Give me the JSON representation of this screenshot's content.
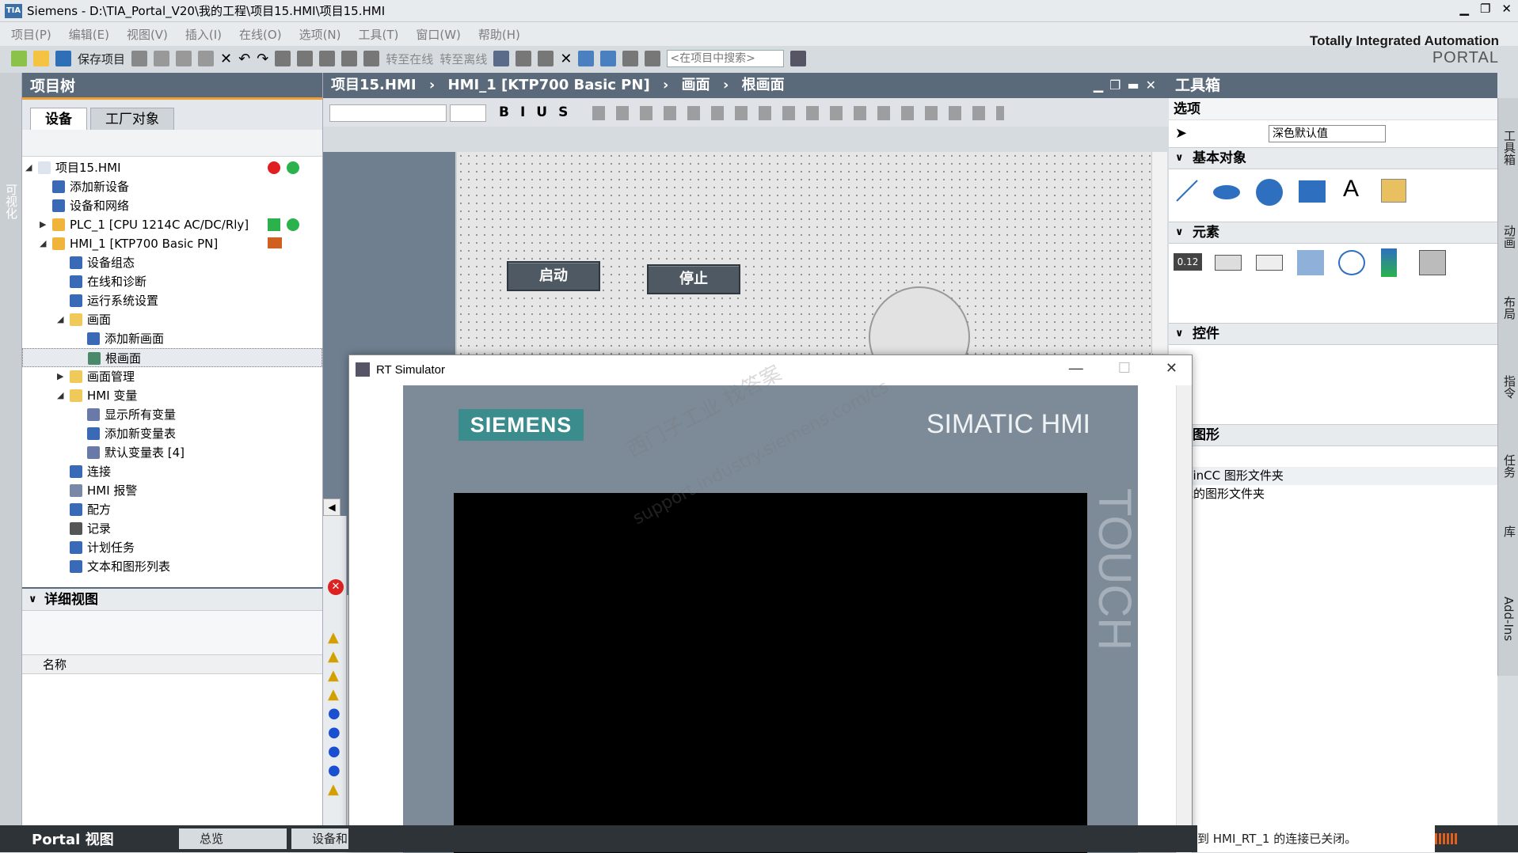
{
  "window": {
    "title": "Siemens  -  D:\\TIA_Portal_V20\\我的工程\\项目15.HMI\\项目15.HMI",
    "logo_text": "TIA"
  },
  "menu": [
    "项目(P)",
    "编辑(E)",
    "视图(V)",
    "插入(I)",
    "在线(O)",
    "选项(N)",
    "工具(T)",
    "窗口(W)",
    "帮助(H)"
  ],
  "toolbar": {
    "save_label": "保存项目",
    "go_online": "转至在线",
    "go_offline": "转至离线",
    "search_placeholder": "<在项目中搜索>"
  },
  "brand": {
    "line1": "Totally Integrated Automation",
    "line2": "PORTAL"
  },
  "left_strip": {
    "label": "可视化"
  },
  "project_tree": {
    "title": "项目树",
    "tabs": [
      "设备",
      "工厂对象"
    ],
    "items": [
      {
        "label": "项目15.HMI",
        "level": 0,
        "expanded": true
      },
      {
        "label": "添加新设备",
        "level": 1
      },
      {
        "label": "设备和网络",
        "level": 1
      },
      {
        "label": "PLC_1 [CPU 1214C AC/DC/Rly]",
        "level": 1,
        "expanded": false
      },
      {
        "label": "HMI_1 [KTP700 Basic PN]",
        "level": 1,
        "expanded": true
      },
      {
        "label": "设备组态",
        "level": 2
      },
      {
        "label": "在线和诊断",
        "level": 2
      },
      {
        "label": "运行系统设置",
        "level": 2
      },
      {
        "label": "画面",
        "level": 2,
        "expanded": true
      },
      {
        "label": "添加新画面",
        "level": 3
      },
      {
        "label": "根画面",
        "level": 3,
        "selected": true
      },
      {
        "label": "画面管理",
        "level": 2,
        "expanded": false
      },
      {
        "label": "HMI 变量",
        "level": 2,
        "expanded": true
      },
      {
        "label": "显示所有变量",
        "level": 3
      },
      {
        "label": "添加新变量表",
        "level": 3
      },
      {
        "label": "默认变量表 [4]",
        "level": 3
      },
      {
        "label": "连接",
        "level": 2
      },
      {
        "label": "HMI 报警",
        "level": 2
      },
      {
        "label": "配方",
        "level": 2
      },
      {
        "label": "记录",
        "level": 2
      },
      {
        "label": "计划任务",
        "level": 2
      },
      {
        "label": "文本和图形列表",
        "level": 2
      }
    ]
  },
  "detail_view": {
    "title": "详细视图",
    "column": "名称"
  },
  "editor": {
    "breadcrumb": [
      "项目15.HMI",
      "HMI_1 [KTP700 Basic PN]",
      "画面",
      "根画面"
    ],
    "btn_start": "启动",
    "btn_stop": "停止"
  },
  "toolbox": {
    "title": "工具箱",
    "options_label": "选项",
    "style_select": "深色默认值",
    "sections": {
      "basic": "基本对象",
      "elements": "元素",
      "controls": "控件",
      "graphics": "图形"
    },
    "graphics_items": [
      "WinCC 图形文件夹",
      "我的图形文件夹"
    ]
  },
  "right_strip": [
    "工具箱",
    "动画",
    "布局",
    "指令",
    "任务",
    "库",
    "Add-Ins"
  ],
  "simulator": {
    "title": "RT Simulator",
    "logo": "SIEMENS",
    "product": "SIMATIC HMI",
    "side": "TOUCH"
  },
  "watermark": {
    "line1": "西门子工业  找答案",
    "line2": "support.industry.siemens.com/cs"
  },
  "status": {
    "portal_label": "Portal 视图",
    "tab1": "总览",
    "tab2": "设备和",
    "message": "到 HMI_RT_1 的连接已关闭。"
  },
  "colors": {
    "panel_header": "#5b6a7a",
    "accent": "#f0a030",
    "siemens_teal": "#3b8c8c"
  }
}
